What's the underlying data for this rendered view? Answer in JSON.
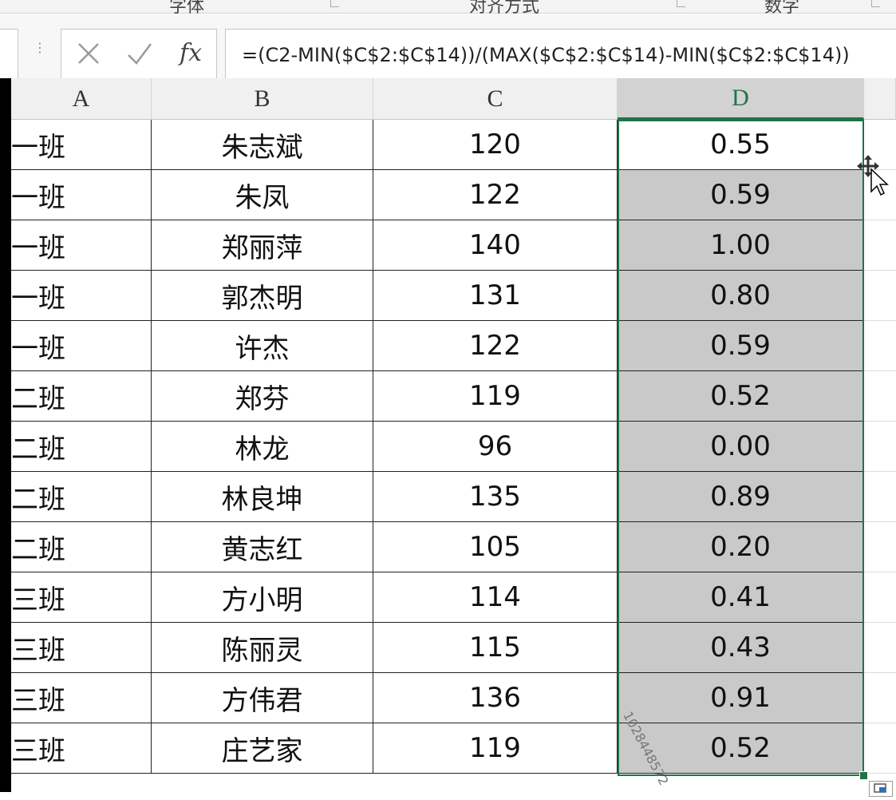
{
  "ribbon": {
    "groups": [
      "字体",
      "对齐方式",
      "数字"
    ]
  },
  "formula_bar": {
    "cancel_icon": "x-icon",
    "enter_icon": "check-icon",
    "fx_label": "fx",
    "formula": "=(C2-MIN($C$2:$C$14))/(MAX($C$2:$C$14)-MIN($C$2:$C$14))"
  },
  "columns": [
    "A",
    "B",
    "C",
    "D"
  ],
  "selected_column": "D",
  "rows": [
    {
      "a": "一班",
      "b": "朱志斌",
      "c": "120",
      "d": "0.55"
    },
    {
      "a": "一班",
      "b": "朱凤",
      "c": "122",
      "d": "0.59"
    },
    {
      "a": "一班",
      "b": "郑丽萍",
      "c": "140",
      "d": "1.00"
    },
    {
      "a": "一班",
      "b": "郭杰明",
      "c": "131",
      "d": "0.80"
    },
    {
      "a": "一班",
      "b": "许杰",
      "c": "122",
      "d": "0.59"
    },
    {
      "a": "二班",
      "b": "郑芬",
      "c": "119",
      "d": "0.52"
    },
    {
      "a": "二班",
      "b": "林龙",
      "c": "96",
      "d": "0.00"
    },
    {
      "a": "二班",
      "b": "林良坤",
      "c": "135",
      "d": "0.89"
    },
    {
      "a": "二班",
      "b": "黄志红",
      "c": "105",
      "d": "0.20"
    },
    {
      "a": "三班",
      "b": "方小明",
      "c": "114",
      "d": "0.41"
    },
    {
      "a": "三班",
      "b": "陈丽灵",
      "c": "115",
      "d": "0.43"
    },
    {
      "a": "三班",
      "b": "方伟君",
      "c": "136",
      "d": "0.91"
    },
    {
      "a": "三班",
      "b": "庄艺家",
      "c": "119",
      "d": "0.52"
    }
  ],
  "watermark": "1028448572",
  "colors": {
    "selection": "#217346",
    "selected_fill": "#c9c9c9",
    "header": "#f0f0f0"
  }
}
